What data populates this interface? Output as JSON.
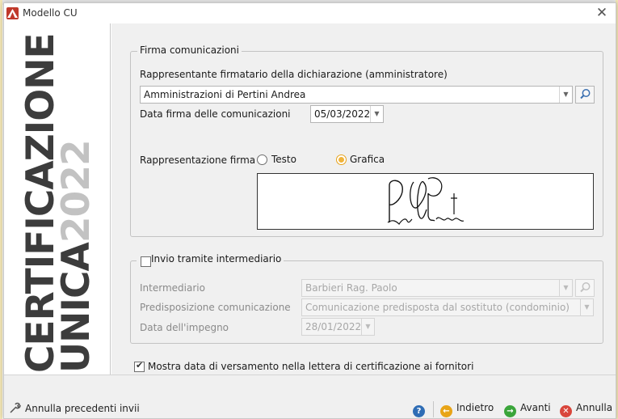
{
  "window": {
    "title": "Modello CU"
  },
  "sidebar": {
    "brand_line1": "CERTIFICAZIONE",
    "brand_line2": "UNICA",
    "brand_year": "2022"
  },
  "firma": {
    "legend": "Firma comunicazioni",
    "rappresentante_label": "Rappresentante firmatario della dichiarazione (amministratore)",
    "rappresentante_value": "Amministrazioni di Pertini Andrea",
    "data_label": "Data firma delle comunicazioni",
    "data_value": "05/03/2022",
    "rappresentazione_label": "Rappresentazione firma",
    "option_testo": "Testo",
    "option_grafica": "Grafica",
    "selected": "Grafica"
  },
  "intermediario": {
    "legend": "Invio tramite intermediario",
    "checked": false,
    "intermediario_label": "Intermediario",
    "intermediario_value": "Barbieri Rag. Paolo",
    "predisposizione_label": "Predisposizione comunicazione",
    "predisposizione_value": "Comunicazione predisposta dal sostituto (condominio)",
    "impegno_label": "Data dell'impegno",
    "impegno_value": "28/01/2022"
  },
  "mostra_data": {
    "label": "Mostra data di versamento nella lettera di certificazione ai fornitori",
    "checked": true
  },
  "footer": {
    "annulla_precedenti": "Annulla precedenti invii",
    "indietro": "Indietro",
    "avanti": "Avanti",
    "annulla": "Annulla"
  },
  "colors": {
    "accent": "#f0b33c",
    "brand": "#3c3c3c",
    "year": "#c2c2c2",
    "annulla": "#d9453b",
    "avanti": "#3aa53a",
    "indietro": "#e8a417",
    "help": "#2f6db5"
  }
}
